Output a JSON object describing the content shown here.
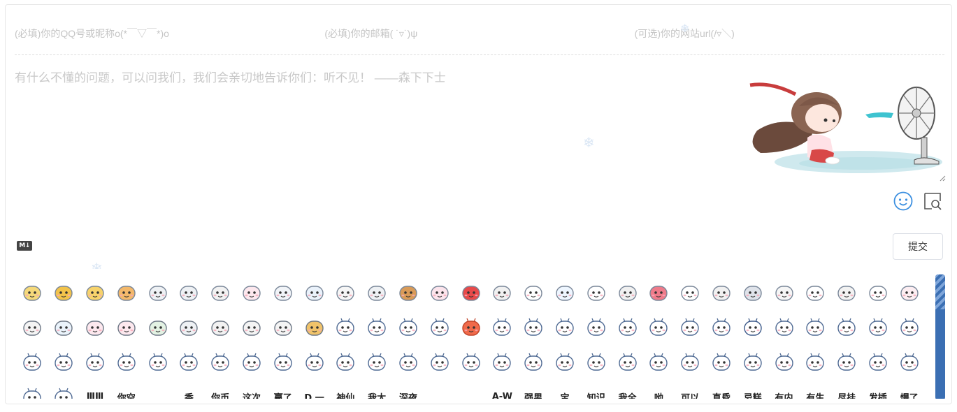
{
  "form": {
    "nick_placeholder": "(必填)你的QQ号或昵称o(*￣▽￣*)o",
    "mail_placeholder": "(必填)你的邮箱( ˙▿˙)ψ",
    "url_placeholder": "(可选)你的网站url(/▿＼)",
    "comment_placeholder": "有什么不懂的问题，可以问我们，我们会亲切地告诉你们：听不见！ ——森下下士"
  },
  "toolbar": {
    "emoji_icon": "smiley-face-icon",
    "preview_icon": "preview-magnifier-icon",
    "markdown_badge": "M↓",
    "submit_label": "提交"
  },
  "emoji_panel": {
    "word_stickers": [
      "",
      "",
      " ⅢⅢ",
      "你空",
      "",
      "香",
      "你币",
      "这次",
      "赢了",
      "D 一",
      "神仙",
      "我太",
      "深夜",
      "",
      "",
      "A-W",
      "强男",
      "宝",
      "知识",
      "我全",
      "呦",
      "可以",
      "直昏",
      "忌糕",
      "有内",
      "有生",
      "尽挂",
      "发插",
      "爆了"
    ]
  },
  "colors": {
    "accent_blue": "#3b8fe0",
    "scrollbar": "#3b6fb3",
    "placeholder_gray": "#c5c5c5"
  }
}
